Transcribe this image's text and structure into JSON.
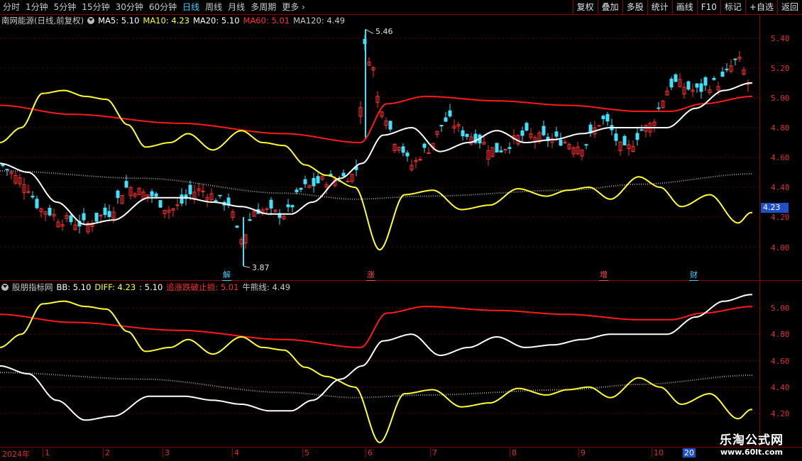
{
  "toolbar": {
    "periods": [
      "分时",
      "1分钟",
      "5分钟",
      "15分钟",
      "30分钟",
      "60分钟",
      "日线",
      "周线",
      "月线",
      "多周期",
      "更多"
    ],
    "active_period": "日线",
    "buttons": [
      "复权",
      "叠加",
      "多股",
      "统计",
      "画线",
      "F10",
      "标记",
      "+自选",
      "返回"
    ]
  },
  "main_legend": {
    "title": "南网能源(日线,前复权)",
    "ma5": "MA5: 5.10",
    "ma10": "MA10: 4.23",
    "ma20": "MA20: 5.10",
    "ma60": "MA60: 5.01",
    "ma120": "MA120: 4.49"
  },
  "sub_legend": {
    "title": "股朋指标网",
    "bb": "BB: 5.10",
    "diff": "DIFF: 4.23",
    "other": ": 5.10",
    "stop": "追涨跌破止损: 5.01",
    "bull": "牛熊线: 4.49"
  },
  "main_axis": [
    "5.40",
    "5.20",
    "5.00",
    "4.80",
    "4.60",
    "4.40",
    "4.20",
    "4.00"
  ],
  "sub_axis": [
    "5.00",
    "4.80",
    "4.60",
    "4.40",
    "4.20"
  ],
  "current_price": "4.23",
  "annotations": {
    "high": "5.46",
    "low": "3.87"
  },
  "events": [
    {
      "label": "解",
      "color": "#3fd0ff"
    },
    {
      "label": "涨",
      "color": "#ff5050"
    },
    {
      "label": "增",
      "color": "#ff5050"
    },
    {
      "label": "财",
      "color": "#3fd0ff"
    }
  ],
  "date_axis": {
    "year": "2024年",
    "months": [
      "1",
      "2",
      "3",
      "4",
      "5",
      "6",
      "7",
      "8",
      "9",
      "10"
    ],
    "current_day": "20"
  },
  "watermark": {
    "title": "乐淘公式网",
    "url": "www.60lt.com"
  },
  "colors": {
    "up": "#ff3030",
    "down": "#40e0ff",
    "yellow": "#ffff30",
    "white": "#ffffff",
    "red_line": "#ff1a1a",
    "grid": "#8b0000"
  }
}
